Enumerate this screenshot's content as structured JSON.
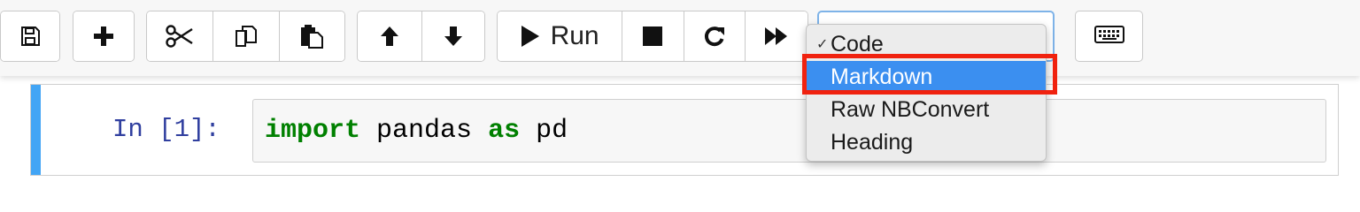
{
  "toolbar": {
    "buttons": [
      {
        "name": "save",
        "icon": "save-icon"
      },
      {
        "name": "insert-cell",
        "icon": "plus-icon"
      },
      {
        "name": "cut",
        "icon": "scissors-icon"
      },
      {
        "name": "copy",
        "icon": "copy-icon"
      },
      {
        "name": "paste",
        "icon": "paste-icon"
      },
      {
        "name": "move-up",
        "icon": "arrow-up-icon"
      },
      {
        "name": "move-down",
        "icon": "arrow-down-icon"
      },
      {
        "name": "run",
        "icon": "play-icon"
      },
      {
        "name": "interrupt",
        "icon": "stop-icon"
      },
      {
        "name": "restart",
        "icon": "restart-icon"
      },
      {
        "name": "restart-run-all",
        "icon": "fast-forward-icon"
      },
      {
        "name": "command-palette",
        "icon": "keyboard-icon"
      }
    ],
    "run_label": "Run",
    "cell_type_select": {
      "selected": "Code",
      "options": [
        "Code",
        "Markdown",
        "Raw NBConvert",
        "Heading"
      ],
      "check_mark": "✓",
      "highlighted_option": "Markdown",
      "highlight_color": "#f0220f",
      "hover_color": "#3b8ff0"
    }
  },
  "cell": {
    "prompt": "In [1]:",
    "code_tokens": [
      {
        "text": "import",
        "type": "keyword"
      },
      {
        "text": " pandas ",
        "type": "plain"
      },
      {
        "text": "as",
        "type": "keyword"
      },
      {
        "text": " pd",
        "type": "plain"
      }
    ],
    "selected_bar_color": "#42a5f5"
  }
}
